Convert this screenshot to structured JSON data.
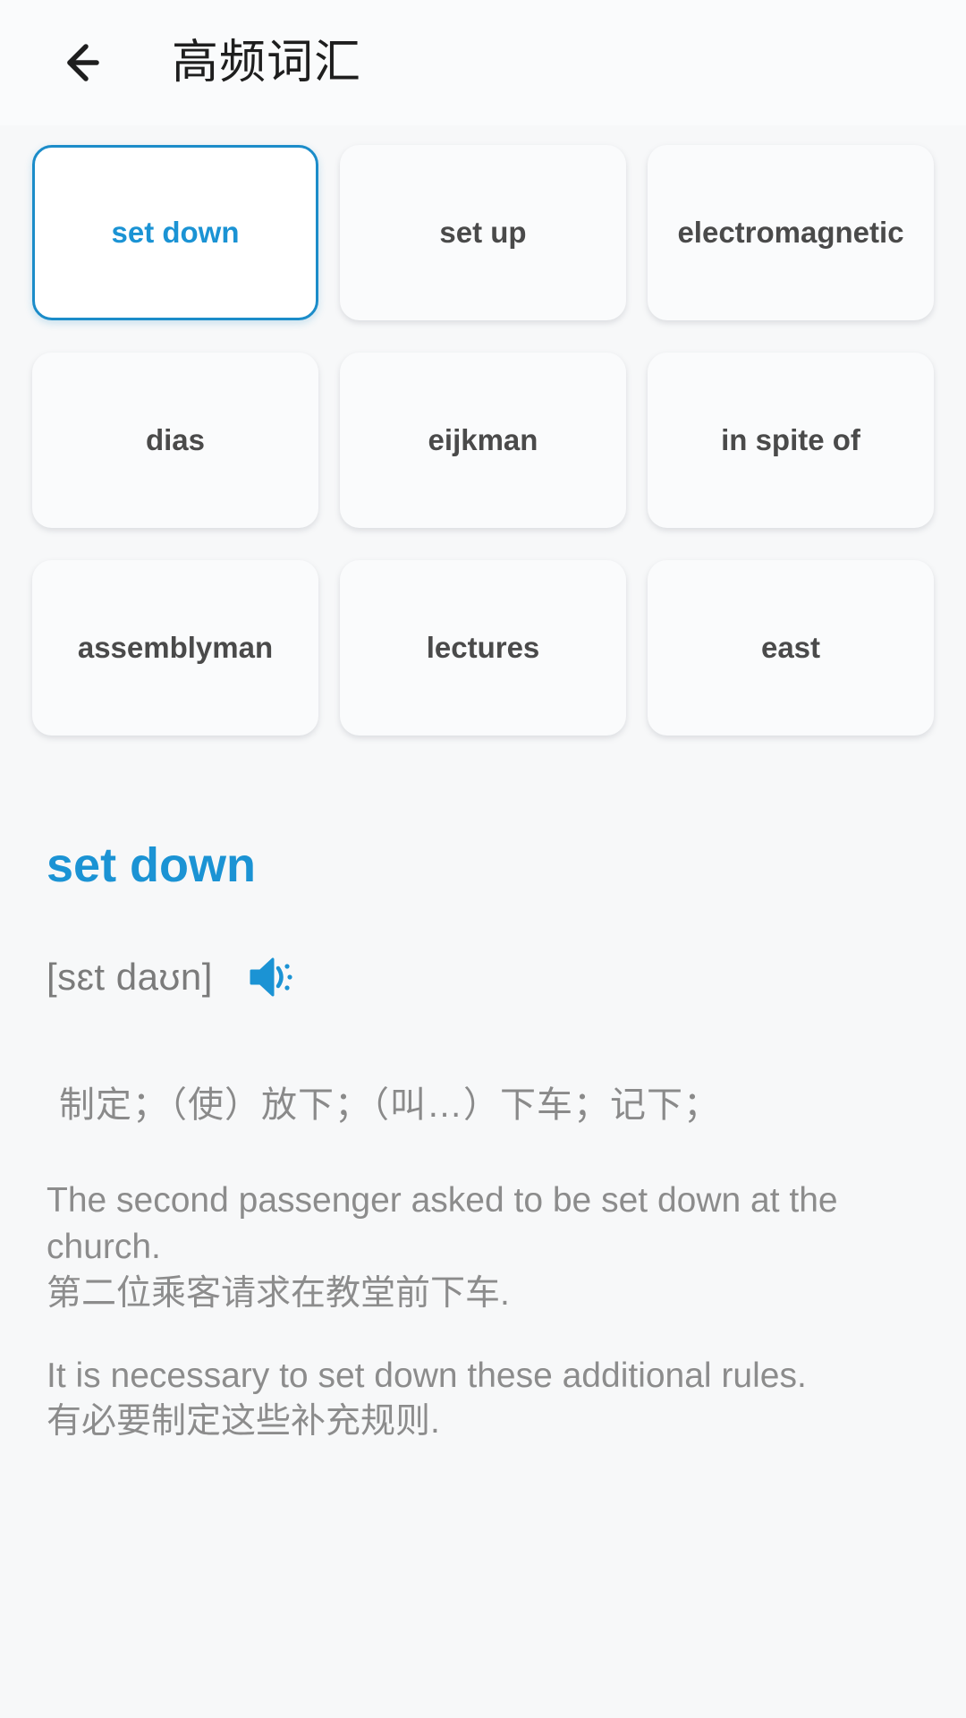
{
  "header": {
    "back_icon": "arrow-left-icon",
    "title": "高频词汇"
  },
  "word_grid": {
    "cards": [
      {
        "label": "set down",
        "selected": true
      },
      {
        "label": "set up",
        "selected": false
      },
      {
        "label": "electromagnetic",
        "selected": false
      },
      {
        "label": "dias",
        "selected": false
      },
      {
        "label": "eijkman",
        "selected": false
      },
      {
        "label": "in spite of",
        "selected": false
      },
      {
        "label": "assemblyman",
        "selected": false
      },
      {
        "label": "lectures",
        "selected": false
      },
      {
        "label": "east",
        "selected": false
      }
    ]
  },
  "detail": {
    "word": "set down",
    "phonetic": "[sɛt daʊn]",
    "speaker_icon": "speaker-icon",
    "definition": "制定；（使）放下；（叫…）下车；记下；",
    "examples": [
      {
        "en": "The second passenger asked to be set down at the church.",
        "zh": "第二位乘客请求在教堂前下车."
      },
      {
        "en": "It is necessary to set down these additional rules.",
        "zh": "有必要制定这些补充规则."
      }
    ]
  },
  "colors": {
    "accent": "#1b93d4",
    "page_background": "#f7f8f9",
    "card_background": "#fafbfc",
    "text_primary": "#4a4a4a",
    "text_secondary": "#8c8c8c",
    "title": "#1e1e1e"
  }
}
